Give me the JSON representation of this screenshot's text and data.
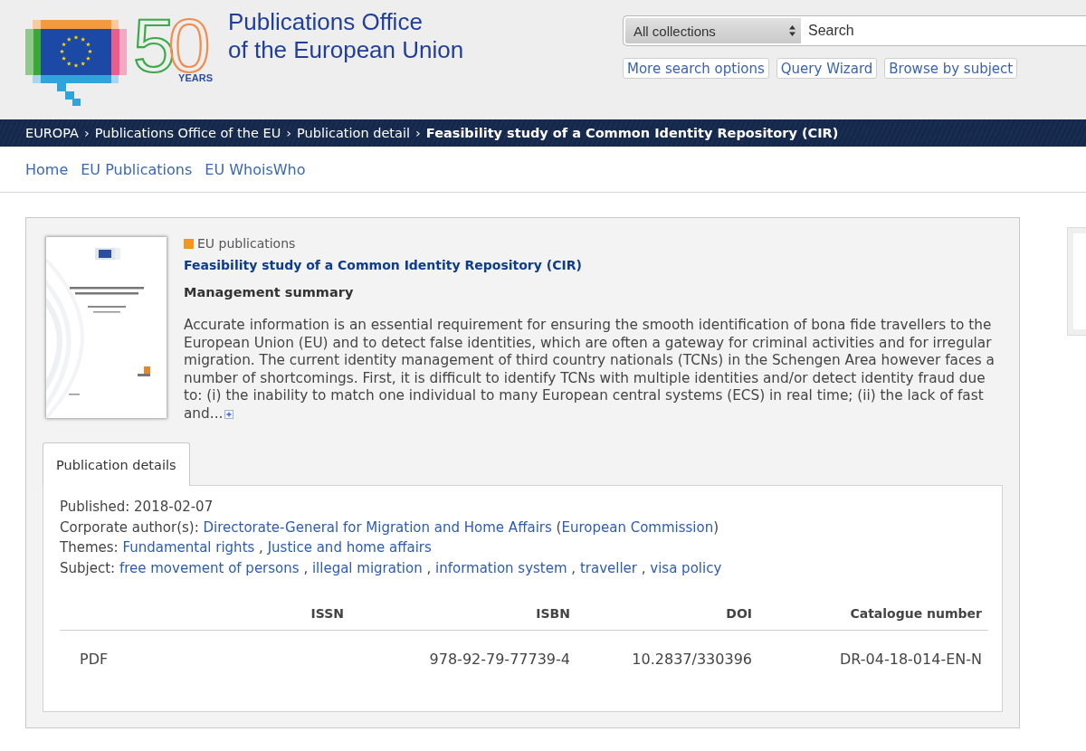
{
  "header": {
    "logo": {
      "number": "50",
      "caption": "YEARS"
    },
    "title_lines": [
      "Publications Office",
      "of the European Union"
    ],
    "search": {
      "collection": "All collections",
      "placeholder": "Search"
    },
    "links": [
      "More search options",
      "Query Wizard",
      "Browse by subject"
    ]
  },
  "breadcrumb": {
    "separator": "›",
    "items": [
      {
        "label": "EUROPA",
        "current": false
      },
      {
        "label": "Publications Office of the EU",
        "current": false
      },
      {
        "label": "Publication detail",
        "current": false
      },
      {
        "label": "Feasibility study of a Common Identity Repository (CIR)",
        "current": true
      }
    ]
  },
  "nav": [
    "Home",
    "EU Publications",
    "EU WhoisWho"
  ],
  "publication": {
    "collection": "EU publications",
    "title": "Feasibility study of a Common Identity Repository (CIR)",
    "subtitle": "Management summary",
    "abstract": "Accurate information is an essential requirement for ensuring the smooth identification of bona fide travellers to the European Union (EU) and to detect false identities, which are often a gateway for criminal activities and for irregular migration. The current identity management of third country nationals (TCNs) in the Schengen Area however faces a number of shortcomings. First, it is difficult to identify TCNs with multiple identities and/or detect identity fraud due to: (i) the inability to match one individual to many European central systems (ECS) in real time; (ii) the lack of fast and...",
    "tabs": [
      {
        "label": "Publication details",
        "selected": true
      }
    ],
    "details": [
      {
        "kind": "text",
        "label": "Published:",
        "value": "2018-02-07"
      },
      {
        "kind": "author",
        "label": "Corporate author(s):",
        "link": "Directorate-General for Migration and Home Affairs",
        "parent": "European Commission",
        "brackets": [
          "(",
          ")"
        ]
      },
      {
        "kind": "links",
        "label": "Themes:",
        "separator": ",",
        "links": [
          "Fundamental rights",
          "Justice and home affairs"
        ]
      },
      {
        "kind": "links",
        "label": "Subject:",
        "separator": ",",
        "links": [
          "free movement of persons",
          "illegal migration",
          "information system",
          "traveller",
          "visa policy"
        ]
      }
    ],
    "table": {
      "columns": [
        "ISSN",
        "ISBN",
        "DOI",
        "Catalogue number"
      ],
      "rows": [
        {
          "format": "PDF",
          "cells": [
            null,
            "978-92-79-77739-4",
            "10.2837/330396",
            "DR-04-18-014-EN-N"
          ]
        }
      ]
    }
  }
}
